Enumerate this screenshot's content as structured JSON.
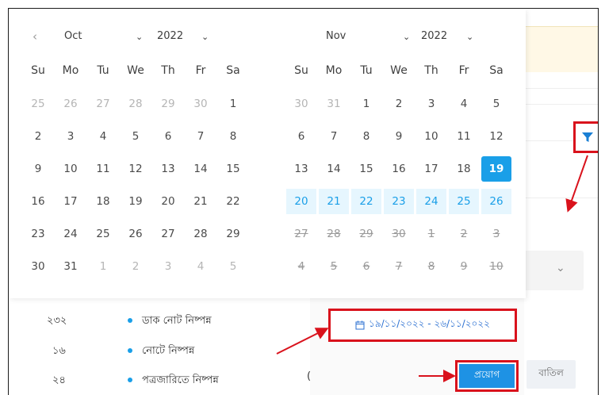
{
  "calendar": {
    "left": {
      "month": "Oct",
      "year": "2022"
    },
    "right": {
      "month": "Nov",
      "year": "2022"
    },
    "weekdays": [
      "Su",
      "Mo",
      "Tu",
      "We",
      "Th",
      "Fr",
      "Sa"
    ],
    "left_weeks": [
      [
        "25",
        "26",
        "27",
        "28",
        "29",
        "30",
        "1"
      ],
      [
        "2",
        "3",
        "4",
        "5",
        "6",
        "7",
        "8"
      ],
      [
        "9",
        "10",
        "11",
        "12",
        "13",
        "14",
        "15"
      ],
      [
        "16",
        "17",
        "18",
        "19",
        "20",
        "21",
        "22"
      ],
      [
        "23",
        "24",
        "25",
        "26",
        "27",
        "28",
        "29"
      ],
      [
        "30",
        "31",
        "1",
        "2",
        "3",
        "4",
        "5"
      ]
    ],
    "right_weeks": [
      [
        "30",
        "31",
        "1",
        "2",
        "3",
        "4",
        "5"
      ],
      [
        "6",
        "7",
        "8",
        "9",
        "10",
        "11",
        "12"
      ],
      [
        "13",
        "14",
        "15",
        "16",
        "17",
        "18",
        "19"
      ],
      [
        "20",
        "21",
        "22",
        "23",
        "24",
        "25",
        "26"
      ],
      [
        "27",
        "28",
        "29",
        "30",
        "1",
        "2",
        "3"
      ],
      [
        "4",
        "5",
        "6",
        "7",
        "8",
        "9",
        "10"
      ]
    ]
  },
  "list": [
    {
      "count": "২৩২",
      "label": "ডাক নোট নিষ্পন্ন"
    },
    {
      "count": "১৬",
      "label": "নোটে নিষ্পন্ন"
    },
    {
      "count": "২৪",
      "label": "পত্রজারিতে নিষ্পন্ন"
    }
  ],
  "date_range": "১৯/১১/২০২২ - ২৬/১১/২০২২",
  "buttons": {
    "apply": "প্রয়োগ",
    "cancel": "বাতিল"
  },
  "paren_fragment": "(",
  "colors": {
    "accent": "#1a9fe8",
    "annotation": "#d9121c"
  },
  "icons": {
    "filter": "filter-icon",
    "calendar": "calendar-icon",
    "prev": "chevron-left-icon"
  }
}
